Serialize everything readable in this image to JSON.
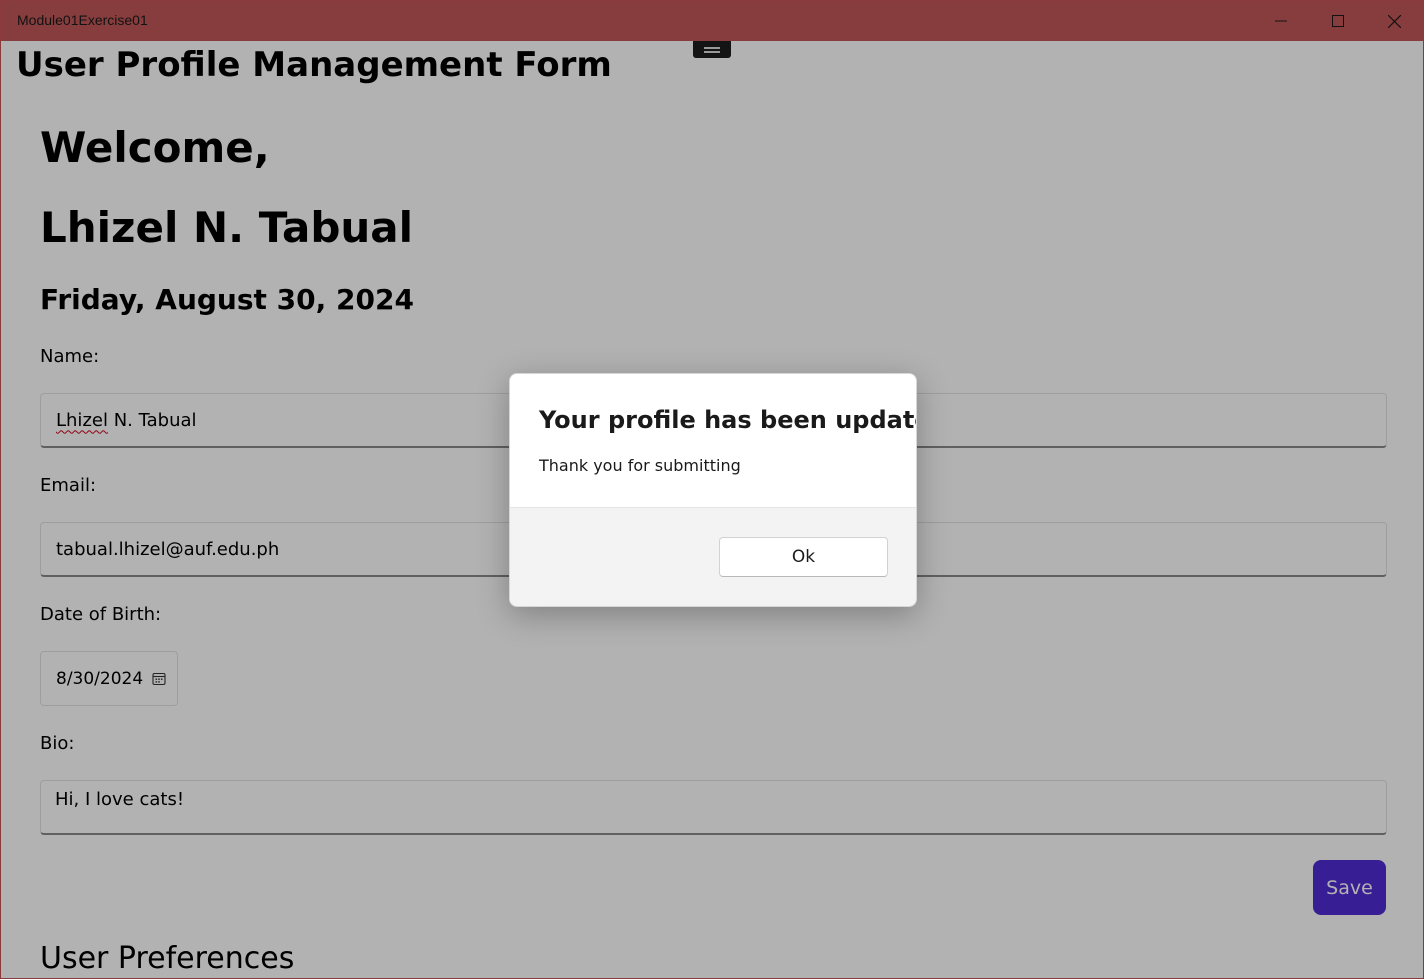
{
  "window": {
    "title": "Module01Exercise01",
    "titlebar_color": "#c25858"
  },
  "page": {
    "title": "User Profile Management Form",
    "welcome": "Welcome,",
    "username": "Lhizel N. Tabual",
    "date": "Friday, August 30, 2024"
  },
  "form": {
    "name_label": "Name:",
    "name_value_first": "Lhizel",
    "name_value_rest": " N. Tabual",
    "email_label": "Email:",
    "email_value": "tabual.lhizel@auf.edu.ph",
    "dob_label": "Date of Birth:",
    "dob_value": "8/30/2024",
    "bio_label": "Bio:",
    "bio_value": "Hi, I love cats!",
    "save_label": "Save",
    "save_color": "#512bd4"
  },
  "preferences": {
    "heading": "User Preferences"
  },
  "dialog": {
    "title": "Your profile has been updated.",
    "message": "Thank you for submitting",
    "ok_label": "Ok"
  },
  "icons": {
    "minimize": "minimize-icon",
    "maximize": "maximize-icon",
    "close": "close-icon",
    "calendar": "calendar-icon"
  }
}
